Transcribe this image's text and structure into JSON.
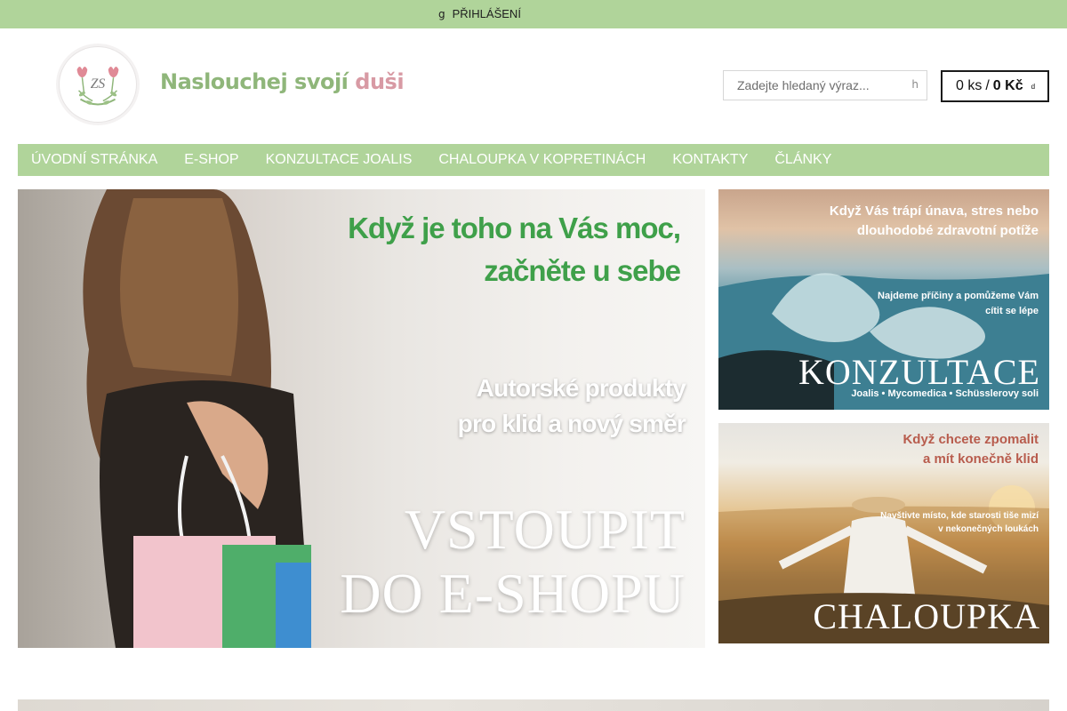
{
  "topbar": {
    "login_icon": "g",
    "login_label": "PŘIHLÁŠENÍ",
    "color": "#b0d49a"
  },
  "brand": {
    "name_part1": "Naslouchej svojí ",
    "name_part2": "duši",
    "logo_mark": "ZS",
    "colors": {
      "green": "#8fb67a",
      "pink": "#d89aa4"
    }
  },
  "search": {
    "placeholder": "Zadejte hledaný výraz...",
    "icon_glyph": "h",
    "icon": "search-icon"
  },
  "cart": {
    "count": "0 ks",
    "separator": "/",
    "total": "0 Kč",
    "icon_glyph": "d",
    "icon": "cart-icon"
  },
  "nav": {
    "items": [
      {
        "label": "ÚVODNÍ STRÁNKA"
      },
      {
        "label": "E-SHOP"
      },
      {
        "label": "KONZULTACE JOALIS"
      },
      {
        "label": "CHALOUPKA V KOPRETINÁCH"
      },
      {
        "label": "KONTAKTY"
      },
      {
        "label": "ČLÁNKY"
      }
    ]
  },
  "banners": {
    "main": {
      "headline_1": "Když je toho na Vás moc,",
      "headline_2": "začněte u sebe",
      "sub_1": "Autorské produkty",
      "sub_2": "pro klid a nový směr",
      "cta_1": "VSTOUPIT",
      "cta_2": "DO E-SHOPU"
    },
    "konzultace": {
      "headline_1": "Když Vás trápí únava, stres nebo",
      "headline_2": "dlouhodobé zdravotní potíže",
      "sub_1": "Najdeme příčiny a pomůžeme Vám",
      "sub_2": "cítit se lépe",
      "title": "KONZULTACE",
      "caption": "Joalis • Mycomedica • Schüsslerovy soli"
    },
    "chaloupka": {
      "headline_1": "Když chcete zpomalit",
      "headline_2": "a mít konečně klid",
      "sub_1": "Navštivte místo, kde starosti tiše mizí",
      "sub_2": "v nekonečných loukách",
      "title": "CHALOUPKA"
    }
  }
}
